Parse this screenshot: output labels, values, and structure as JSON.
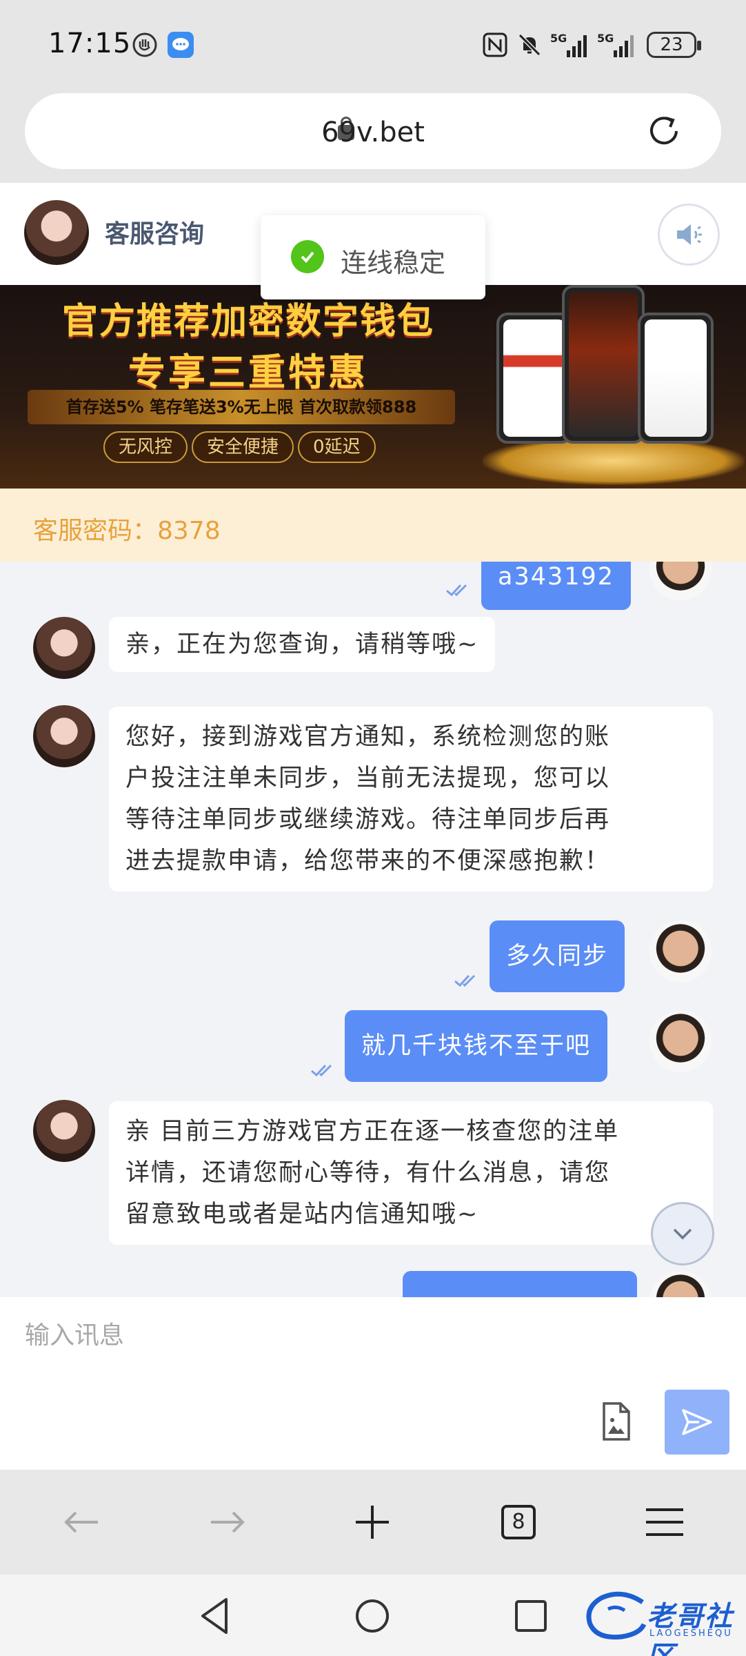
{
  "status_bar": {
    "time": "17:15",
    "network1": "5G",
    "network2": "5G",
    "battery": "23",
    "icons": [
      "hand-icon",
      "message-app-icon",
      "nfc-icon",
      "mute-icon",
      "signal-icon",
      "signal-icon",
      "battery-icon"
    ]
  },
  "browser": {
    "url": "69v.bet",
    "tabs_count": "8"
  },
  "chat_header": {
    "title": "客服咨询"
  },
  "toast": {
    "text": "连线稳定"
  },
  "banner": {
    "line1": "官方推荐加密数字钱包",
    "line2": "专享三重特惠",
    "promo": "首存送5% 笔存笔送3%无上限 首次取款领888",
    "tags": [
      "无风控",
      "安全便捷",
      "0延迟"
    ]
  },
  "password_strip": {
    "text": "客服密码：8378"
  },
  "messages": [
    {
      "role": "user",
      "text": "a343192"
    },
    {
      "role": "agent",
      "text": "亲，正在为您查询，请稍等哦~"
    },
    {
      "role": "agent",
      "lines": [
        "您好，接到游戏官方通知，系统检测您的账",
        "户投注注单未同步，当前无法提现，您可以",
        "等待注单同步或继续游戏。待注单同步后再",
        "进去提款申请，给您带来的不便深感抱歉！"
      ]
    },
    {
      "role": "user",
      "text": "多久同步"
    },
    {
      "role": "user",
      "text": "就几千块钱不至于吧"
    },
    {
      "role": "agent",
      "lines": [
        "亲 目前三方游戏官方正在逐一核查您的注单",
        "详情，还请您耐心等待，有什么消息，请您",
        "留意致电或者是站内信通知哦~"
      ]
    }
  ],
  "input": {
    "placeholder": "输入讯息",
    "value": ""
  },
  "watermark": {
    "text": "老哥社区",
    "sub": "LAOGESHEQU"
  },
  "colors": {
    "user_bubble": "#5b8df7",
    "send_button": "#8fb2fb",
    "password_text": "#e6a23c",
    "password_bg": "#fdefd6",
    "toast_check": "#52c41a"
  }
}
